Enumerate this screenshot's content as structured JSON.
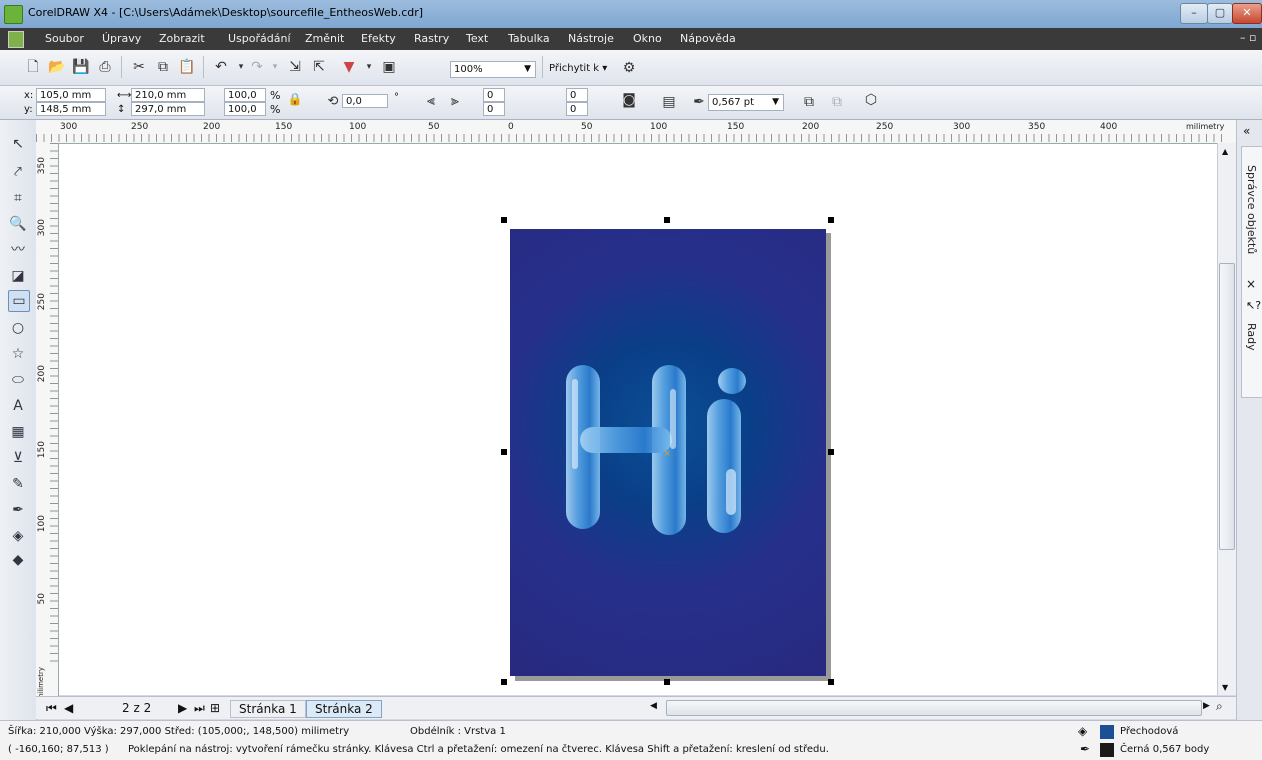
{
  "window": {
    "title": "CorelDRAW X4 - [C:\\Users\\Adámek\\Desktop\\sourcefile_EntheosWeb.cdr]",
    "minimize": "–",
    "maximize": "▢",
    "close": "✕"
  },
  "menu": [
    "Soubor",
    "Úpravy",
    "Zobrazit",
    "Uspořádání",
    "Změnit",
    "Efekty",
    "Rastry",
    "Text",
    "Tabulka",
    "Nástroje",
    "Okno",
    "Nápověda"
  ],
  "toolbar": {
    "zoom_value": "100%",
    "snap_label": "Přichytit k"
  },
  "properties": {
    "x_label": "x:",
    "y_label": "y:",
    "x_value": "105,0 mm",
    "y_value": "148,5 mm",
    "width_value": "210,0 mm",
    "height_value": "297,0 mm",
    "scale_x": "100,0",
    "scale_y": "100,0",
    "percent": "%",
    "rotation": "0,0",
    "degree": "°",
    "corner_values": [
      "0",
      "0",
      "0",
      "0"
    ],
    "outline_width": "0,567 pt"
  },
  "ruler": {
    "h_ticks": [
      "300",
      "250",
      "200",
      "150",
      "100",
      "50",
      "0",
      "50",
      "100",
      "150",
      "200",
      "250",
      "300",
      "350",
      "400"
    ],
    "unit": "milimetry",
    "v_ticks": [
      "350",
      "300",
      "250",
      "200",
      "150",
      "100",
      "50"
    ],
    "v_unit": "milimetry"
  },
  "docker": {
    "object_manager": "Správce objektů",
    "hints": "Rady"
  },
  "pages": {
    "counter": "2 z 2",
    "tabs": [
      "Stránka 1",
      "Stránka 2"
    ],
    "active_index": 1
  },
  "status": {
    "line1_dims": "Šířka: 210,000  Výška: 297,000  Střed: (105,000;, 148,500)  milimetry",
    "line1_object": "Obdélník : Vrstva 1",
    "line2_coords": "( -160,160; 87,513 )",
    "line2_hint": "Poklepání na nástroj: vytvoření rámečku stránky. Klávesa Ctrl a přetažení: omezení na čtverec. Klávesa Shift a přetažení: kreslení od středu.",
    "fill_label": "Přechodová",
    "outline_label": "Černá  0,567 body",
    "fill_color": "#1d4f97",
    "outline_color": "#1a1a1a"
  },
  "artwork_text": "Hi"
}
